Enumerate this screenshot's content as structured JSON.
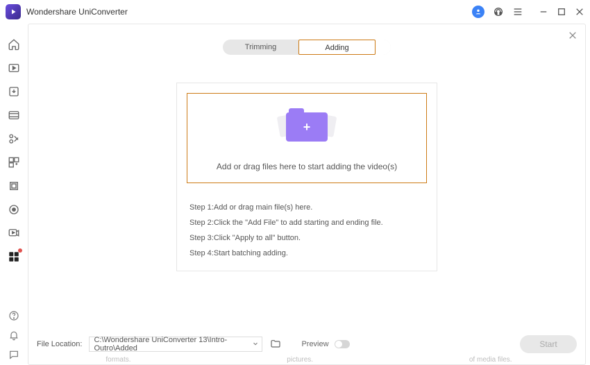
{
  "app": {
    "title": "Wondershare UniConverter"
  },
  "segmented": {
    "trimming": "Trimming",
    "adding": "Adding"
  },
  "drop": {
    "text": "Add or drag files here to start adding the video(s)"
  },
  "steps": {
    "s1": "Step 1:Add or drag main file(s) here.",
    "s2": "Step 2:Click the \"Add File\" to add starting and ending file.",
    "s3": "Step 3:Click \"Apply to all\" button.",
    "s4": "Step 4:Start batching adding."
  },
  "footer": {
    "fileLocationLabel": "File Location:",
    "path": "C:\\Wondershare UniConverter 13\\Intro-Outro\\Added",
    "previewLabel": "Preview",
    "startLabel": "Start"
  },
  "bg": {
    "w1": "formats.",
    "w2": "pictures.",
    "w3": "of media files."
  }
}
